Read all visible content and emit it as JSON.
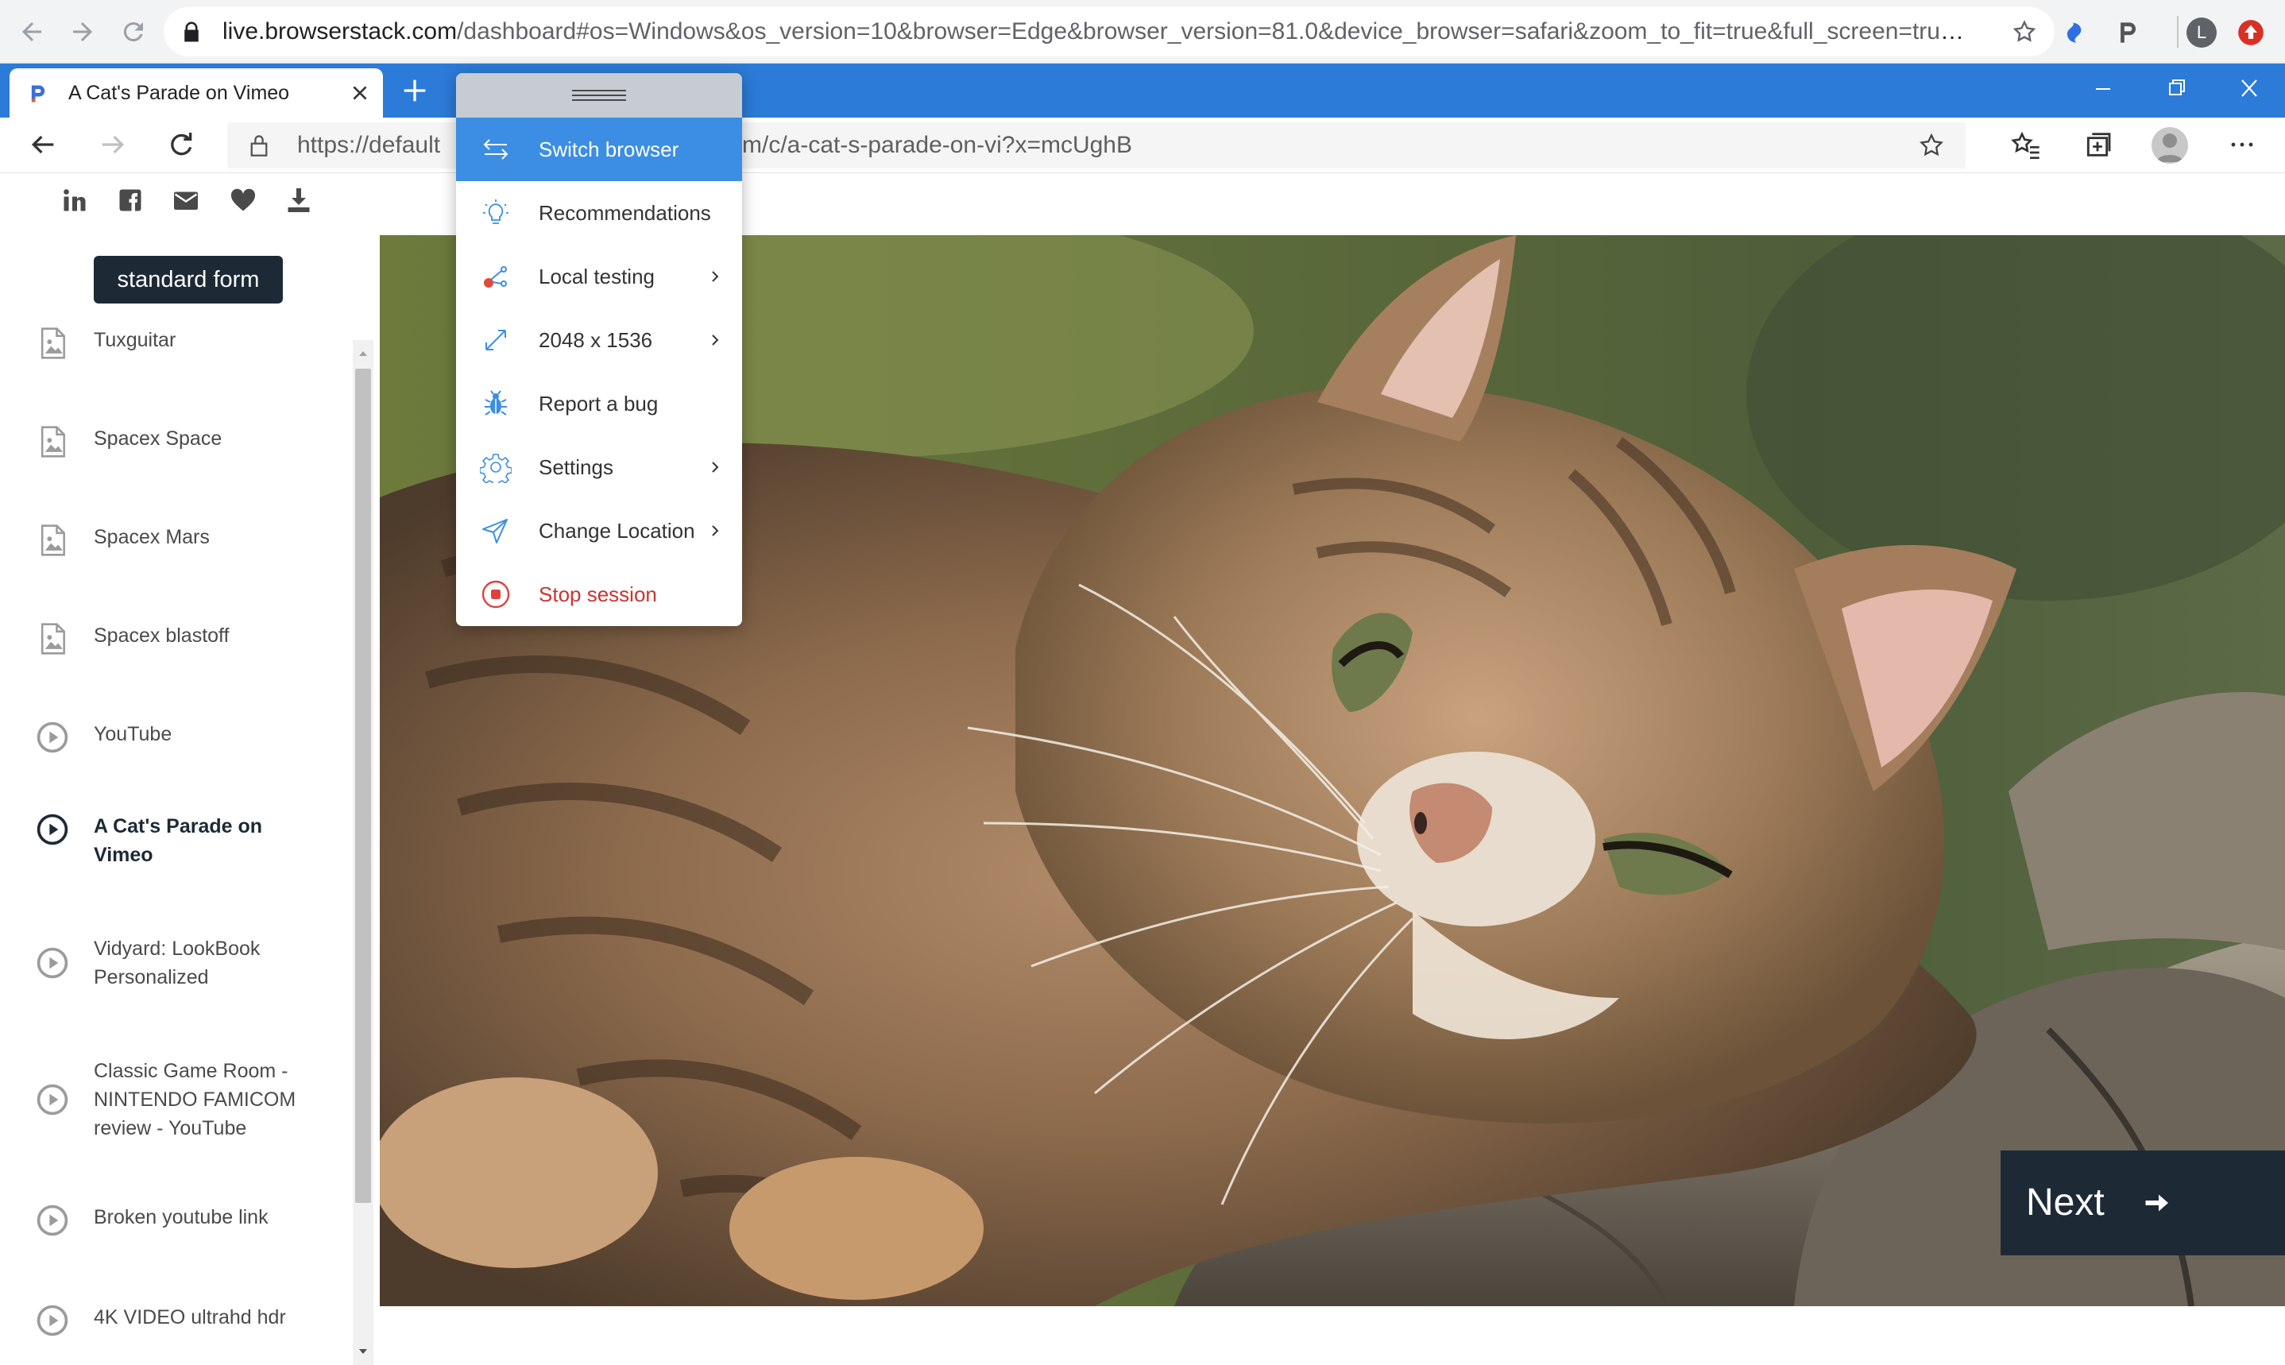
{
  "chrome": {
    "url_domain": "live.browserstack.com",
    "url_rest": "/dashboard#os=Windows&os_version=10&browser=Edge&browser_version=81.0&device_browser=safari&zoom_to_fit=true&full_screen=true&r...",
    "profile_initial": "L",
    "icons": [
      "back-icon",
      "forward-icon",
      "reload-icon",
      "lock-icon",
      "star-icon",
      "extension-icon",
      "profile-avatar",
      "update-icon"
    ]
  },
  "edge": {
    "tab_title": "A Cat's Parade on Vimeo",
    "url_prefix": "https://default",
    "url_suffix": "m/c/a-cat-s-parade-on-vi?x=mcUghB",
    "titlebar_color": "#2c7bd8"
  },
  "sidebar": {
    "share_icons": [
      "linkedin-icon",
      "facebook-icon",
      "email-icon",
      "heart-icon",
      "download-icon"
    ],
    "standard_form_label": "standard form",
    "items": [
      {
        "label": "Tuxguitar",
        "icon": "image-icon",
        "active": false
      },
      {
        "label": "Spacex Space",
        "icon": "image-icon",
        "active": false
      },
      {
        "label": "Spacex Mars",
        "icon": "image-icon",
        "active": false
      },
      {
        "label": "Spacex blastoff",
        "icon": "image-icon",
        "active": false
      },
      {
        "label": "YouTube",
        "icon": "play-icon",
        "active": false
      },
      {
        "label": "A Cat's Parade on Vimeo",
        "icon": "play-icon",
        "active": true
      },
      {
        "label": "Vidyard: LookBook Personalized",
        "icon": "play-icon",
        "active": false
      },
      {
        "label": "Classic Game Room - NINTENDO FAMICOM review - YouTube",
        "icon": "play-icon",
        "active": false
      },
      {
        "label": "Broken youtube link",
        "icon": "play-icon",
        "active": false
      },
      {
        "label": "4K VIDEO ultrahd hdr",
        "icon": "play-icon",
        "active": false
      }
    ]
  },
  "main": {
    "next_label": "Next"
  },
  "bs_menu": {
    "items": [
      {
        "label": "Switch browser",
        "icon": "switch-icon",
        "active": true,
        "has_submenu": false
      },
      {
        "label": "Recommendations",
        "icon": "lightbulb-icon",
        "active": false,
        "has_submenu": false
      },
      {
        "label": "Local testing",
        "icon": "local-testing-icon",
        "active": false,
        "has_submenu": true
      },
      {
        "label": "2048 x 1536",
        "icon": "resize-icon",
        "active": false,
        "has_submenu": true
      },
      {
        "label": "Report a bug",
        "icon": "bug-icon",
        "active": false,
        "has_submenu": false
      },
      {
        "label": "Settings",
        "icon": "gear-icon",
        "active": false,
        "has_submenu": true
      },
      {
        "label": "Change Location",
        "icon": "location-icon",
        "active": false,
        "has_submenu": true
      },
      {
        "label": "Stop session",
        "icon": "stop-icon",
        "active": false,
        "has_submenu": false,
        "danger": true
      }
    ],
    "accent_color": "#3b8ee3",
    "danger_color": "#cc3333"
  }
}
